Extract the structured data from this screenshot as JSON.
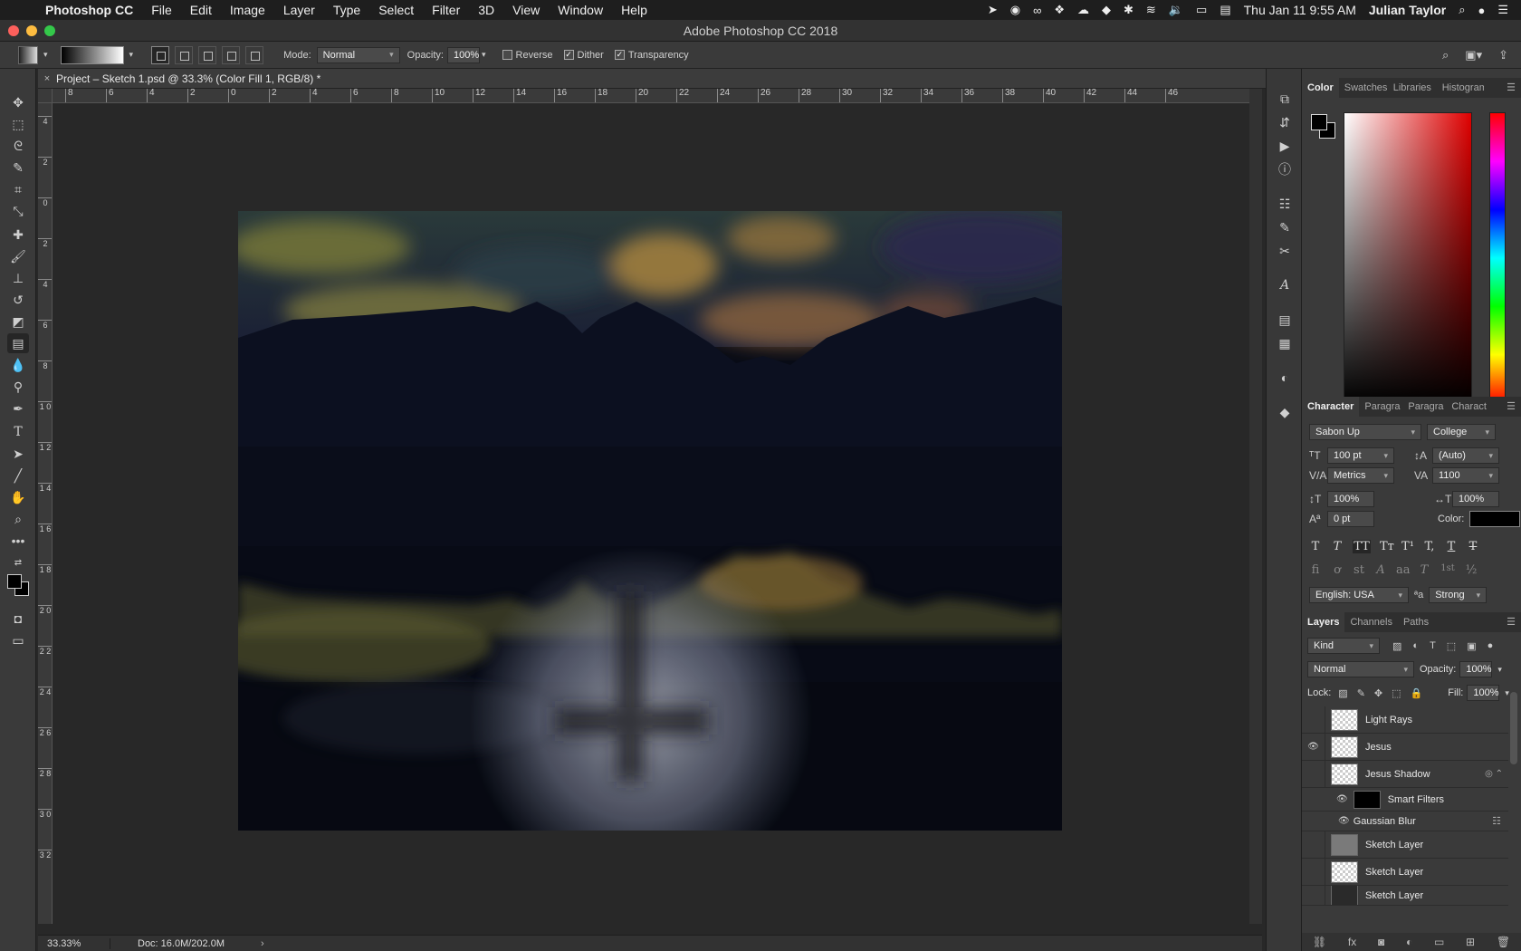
{
  "menubar": {
    "apple": "",
    "items": [
      "Photoshop CC",
      "File",
      "Edit",
      "Image",
      "Layer",
      "Type",
      "Select",
      "Filter",
      "3D",
      "View",
      "Window",
      "Help"
    ],
    "datetime": "Thu Jan 11  9:55 AM",
    "user": "Julian Taylor"
  },
  "window": {
    "title": "Adobe Photoshop CC 2018"
  },
  "options": {
    "mode_label": "Mode:",
    "mode_value": "Normal",
    "opacity_label": "Opacity:",
    "opacity_value": "100%",
    "reverse_label": "Reverse",
    "reverse_checked": false,
    "dither_label": "Dither",
    "dither_checked": true,
    "transparency_label": "Transparency",
    "transparency_checked": true
  },
  "document": {
    "tab_title": "Project – Sketch 1.psd @ 33.3% (Color Fill 1, RGB/8) *",
    "close_glyph": "×"
  },
  "rulers": {
    "h_labels": [
      "8",
      "6",
      "4",
      "2",
      "0",
      "2",
      "4",
      "6",
      "8",
      "10",
      "12",
      "14",
      "16",
      "18",
      "20",
      "22",
      "24",
      "26",
      "28",
      "30",
      "32",
      "34",
      "36",
      "38",
      "40",
      "42",
      "44",
      "46"
    ],
    "v_labels": [
      "4",
      "2",
      "0",
      "2",
      "4",
      "6",
      "8",
      "1 0",
      "1 2",
      "1 4",
      "1 6",
      "1 8",
      "2 0",
      "2 2",
      "2 4",
      "2 6",
      "2 8",
      "3 0",
      "3 2"
    ]
  },
  "status": {
    "zoom": "33.33%",
    "doc": "Doc: 16.0M/202.0M",
    "arrow": "›"
  },
  "color_panel": {
    "tabs": [
      "Color",
      "Swatches",
      "Libraries",
      "Histogram"
    ],
    "active_tab": "Color",
    "fg_color": "#000000",
    "bg_color": "#000000",
    "hue_color": "#e00000"
  },
  "character_panel": {
    "tabs": [
      "Character",
      "Paragra",
      "Paragra",
      "Charact"
    ],
    "font_family": "Sabon Up",
    "font_style": "College",
    "size": "100 pt",
    "leading": "(Auto)",
    "kerning": "Metrics",
    "tracking": "1100",
    "vscale": "100%",
    "hscale": "100%",
    "baseline": "0 pt",
    "color_label": "Color:",
    "color_value": "#000000",
    "type_buttons": [
      "T",
      "T",
      "TT",
      "Tт",
      "T¹",
      "T,",
      "T",
      "T"
    ],
    "ot_buttons": [
      "fi",
      "ơ",
      "st",
      "A",
      "aa",
      "T",
      "1st",
      "½"
    ],
    "language": "English: USA",
    "aa_icon": "ªa",
    "antialias": "Strong"
  },
  "layers_panel": {
    "tabs": [
      "Layers",
      "Channels",
      "Paths"
    ],
    "filter_kind": "Kind",
    "blend_mode": "Normal",
    "opacity_label": "Opacity:",
    "opacity": "100%",
    "lock_label": "Lock:",
    "fill_label": "Fill:",
    "fill": "100%",
    "layers": [
      {
        "name": "Light Rays",
        "visible": false
      },
      {
        "name": "Jesus",
        "visible": true
      },
      {
        "name": "Jesus Shadow",
        "visible": false
      },
      {
        "name": "Smart Filters",
        "visible": true
      },
      {
        "name": "Gaussian Blur",
        "visible": true
      },
      {
        "name": "Sketch Layer",
        "visible": false
      },
      {
        "name": "Sketch Layer",
        "visible": false
      },
      {
        "name": "Sketch Layer",
        "visible": false
      }
    ]
  }
}
